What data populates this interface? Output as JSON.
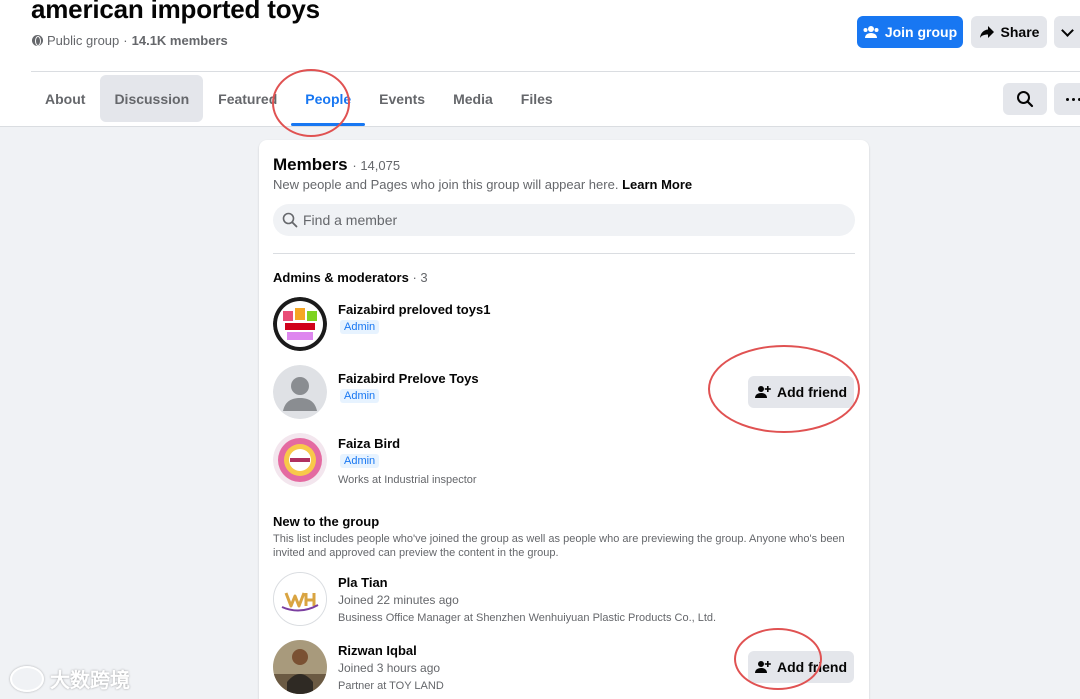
{
  "group": {
    "title": "american imported toys",
    "privacy": "Public group",
    "separator": "·",
    "members_short": "14.1K members"
  },
  "actions": {
    "join_label": "Join group",
    "share_label": "Share"
  },
  "tabs": [
    {
      "label": "About"
    },
    {
      "label": "Discussion"
    },
    {
      "label": "Featured"
    },
    {
      "label": "People"
    },
    {
      "label": "Events"
    },
    {
      "label": "Media"
    },
    {
      "label": "Files"
    }
  ],
  "members": {
    "heading": "Members",
    "count": "· 14,075",
    "subtitle": "New people and Pages who join this group will appear here.",
    "learn_more": "Learn More",
    "search_placeholder": "Find a member"
  },
  "admins": {
    "title": "Admins & moderators",
    "count": "· 3",
    "people": [
      {
        "name": "Faizabird preloved toys1",
        "role": "Admin",
        "detail": ""
      },
      {
        "name": "Faizabird Prelove Toys",
        "role": "Admin",
        "detail": "",
        "action": "Add friend"
      },
      {
        "name": "Faiza Bird",
        "role": "Admin",
        "detail": "Works at Industrial inspector"
      }
    ]
  },
  "new_members": {
    "title": "New to the group",
    "description": "This list includes people who've joined the group as well as people who are previewing the group. Anyone who's been invited and approved can preview the content in the group.",
    "people": [
      {
        "name": "Pla Tian",
        "joined": "Joined 22 minutes ago",
        "detail": "Business Office Manager at Shenzhen Wenhuiyuan Plastic Products Co., Ltd."
      },
      {
        "name": "Rizwan Iqbal",
        "joined": "Joined 3 hours ago",
        "detail": "Partner at TOY LAND",
        "action": "Add friend"
      }
    ]
  },
  "watermark": "大数跨境",
  "colors": {
    "accent": "#1877f2",
    "annotation": "#e05252",
    "background": "#f0f2f5"
  }
}
